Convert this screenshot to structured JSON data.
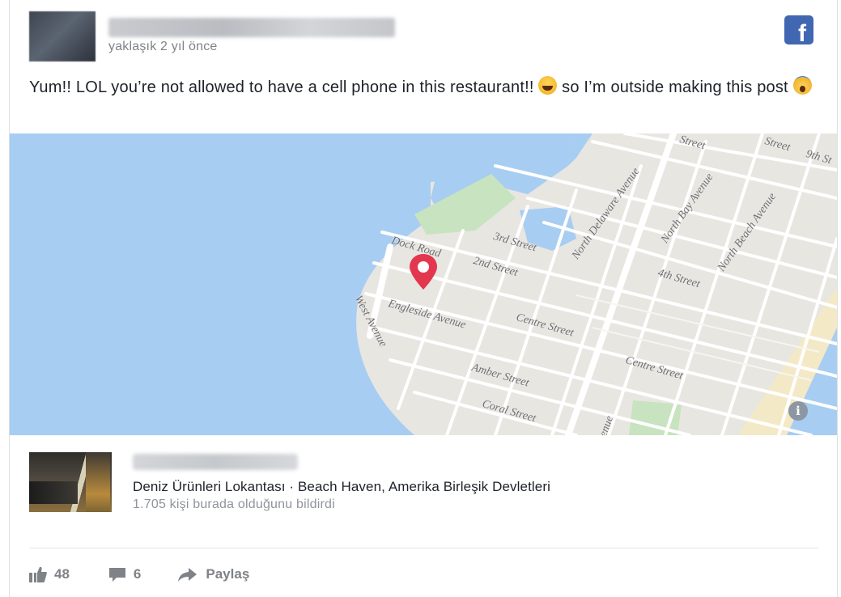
{
  "post": {
    "author_name": "████████████",
    "timestamp": "yaklaşık 2 yıl önce",
    "source_logo": "f",
    "text_part1": "Yum!! LOL you’re not allowed to have a cell phone in this restaurant!! ",
    "text_part2": " so I’m outside making this post ",
    "emojis": [
      "rolling-laughing-emoji",
      "screaming-emoji"
    ]
  },
  "map": {
    "streets": [
      "Dock Road",
      "3rd Street",
      "2nd Street",
      "North Delaware Avenue",
      "North Bay Avenue",
      "North Beach Avenue",
      "4th Street",
      "Engleside Avenue",
      "West Avenue",
      "Centre Street",
      "Centre Street",
      "Amber Street",
      "Coral Street",
      "Street",
      "Street",
      "9th St",
      "enue"
    ],
    "info_glyph": "i",
    "colors": {
      "water": "#a7cdf2",
      "land": "#e8e6e1",
      "road": "#ffffff",
      "park": "#c8e3bf",
      "pin": "#e2374f",
      "beach": "#f3e9c6"
    }
  },
  "place": {
    "name": "████ ████ ███",
    "category": "Deniz Ürünleri Lokantası · Beach Haven, Amerika Birleşik Devletleri",
    "checkins": "1.705 kişi burada olduğunu bildirdi"
  },
  "actions": {
    "likes": "48",
    "comments": "6",
    "share_label": "Paylaş"
  }
}
